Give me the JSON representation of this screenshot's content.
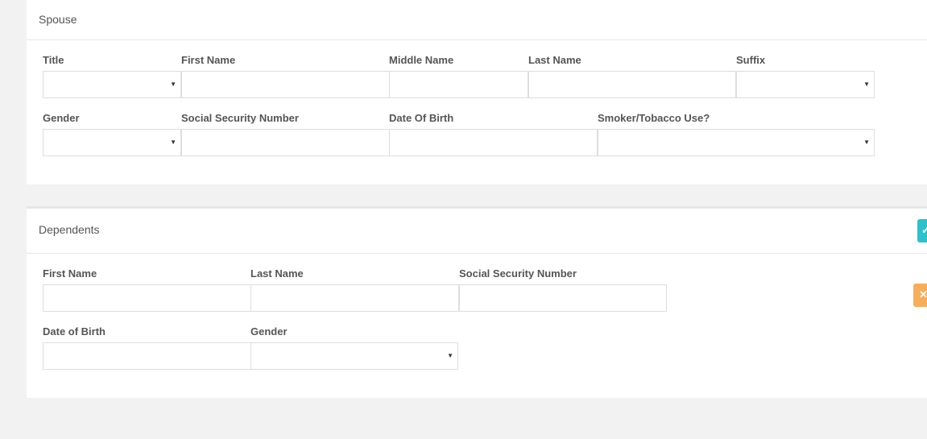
{
  "spouse": {
    "title": "Spouse",
    "fields": {
      "title_label": "Title",
      "first_name_label": "First Name",
      "middle_name_label": "Middle Name",
      "last_name_label": "Last Name",
      "suffix_label": "Suffix",
      "gender_label": "Gender",
      "ssn_label": "Social Security Number",
      "dob_label": "Date Of Birth",
      "smoker_label": "Smoker/Tobacco Use?"
    },
    "values": {
      "title": "",
      "first_name": "",
      "middle_name": "",
      "last_name": "",
      "suffix": "",
      "gender": "",
      "ssn": "",
      "dob": "",
      "smoker": ""
    }
  },
  "dependents": {
    "title": "Dependents",
    "fields": {
      "first_name_label": "First Name",
      "last_name_label": "Last Name",
      "ssn_label": "Social Security Number",
      "dob_label": "Date of Birth",
      "gender_label": "Gender"
    },
    "values": {
      "first_name": "",
      "last_name": "",
      "ssn": "",
      "dob": "",
      "gender": ""
    },
    "add_button_icon": "check-icon",
    "remove_button_icon": "close-icon",
    "add_button_color": "#2cc1cc",
    "remove_button_color": "#f7ae5a"
  },
  "icons": {
    "caret": "▼",
    "remove": "✕",
    "add": "✓"
  }
}
